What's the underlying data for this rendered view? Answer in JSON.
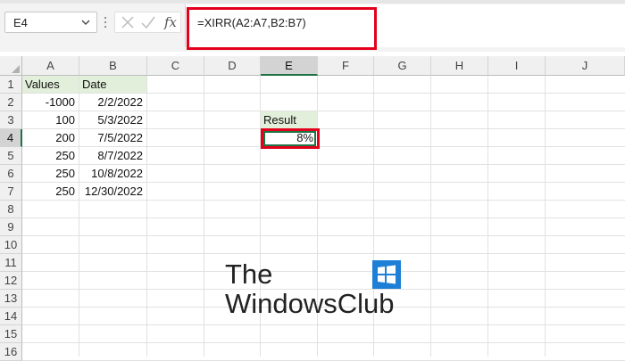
{
  "formula_bar": {
    "name_box": "E4",
    "fx_label": "fx",
    "formula": "=XIRR(A2:A7,B2:B7)"
  },
  "columns": [
    "A",
    "B",
    "C",
    "D",
    "E",
    "F",
    "G",
    "H",
    "I",
    "J"
  ],
  "rows": [
    "1",
    "2",
    "3",
    "4",
    "5",
    "6",
    "7",
    "8",
    "9",
    "10",
    "11",
    "12",
    "13",
    "14",
    "15",
    "16"
  ],
  "selected_cell": "E4",
  "table": {
    "header_values": "Values",
    "header_date": "Date",
    "rows": [
      {
        "value": "-1000",
        "date": "2/2/2022"
      },
      {
        "value": "100",
        "date": "5/3/2022"
      },
      {
        "value": "200",
        "date": "7/5/2022"
      },
      {
        "value": "250",
        "date": "8/7/2022"
      },
      {
        "value": "250",
        "date": "10/8/2022"
      },
      {
        "value": "250",
        "date": "12/30/2022"
      }
    ]
  },
  "result": {
    "label": "Result",
    "value": "8%"
  },
  "watermark": {
    "line1": "The",
    "line2": "WindowsClub"
  },
  "colors": {
    "highlight_red": "#e3001b",
    "excel_green": "#217346",
    "header_fill": "#e2efda",
    "logo_blue": "#1e7fd6"
  }
}
